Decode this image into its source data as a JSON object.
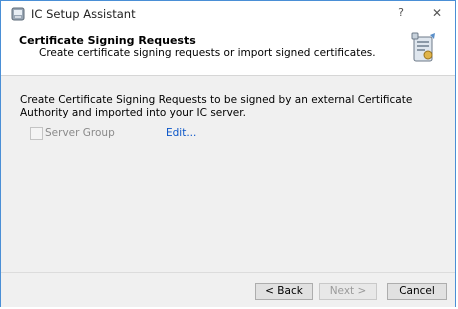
{
  "window": {
    "title": "IC Setup Assistant",
    "help_label": "?",
    "close_label": "✕"
  },
  "header": {
    "title": "Certificate Signing Requests",
    "subtitle": "Create certificate signing requests or import signed certificates."
  },
  "content": {
    "description": "Create Certificate Signing Requests to be signed by an external Certificate Authority and imported into your IC server.",
    "checkbox_label": "Server Group",
    "checkbox_checked": false,
    "checkbox_enabled": false,
    "edit_link": "Edit..."
  },
  "footer": {
    "back_label": "< Back",
    "next_label": "Next >",
    "cancel_label": "Cancel",
    "next_enabled": false
  },
  "colors": {
    "window_border": "#4a8fd6",
    "link": "#0a55c8",
    "disabled_text": "#8a8a8a"
  }
}
